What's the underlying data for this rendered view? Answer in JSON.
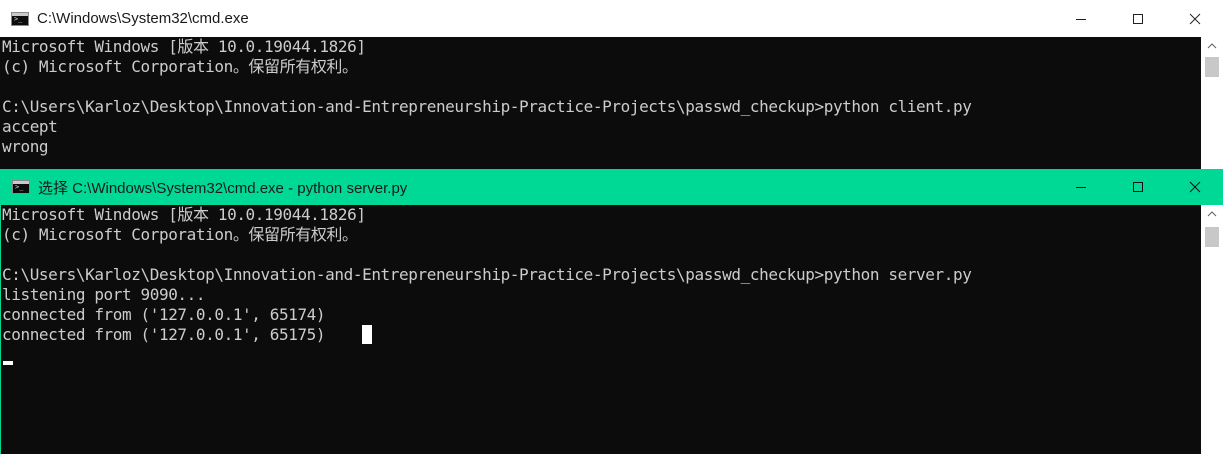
{
  "window_back": {
    "title": "C:\\Windows\\System32\\cmd.exe",
    "lines": [
      "Microsoft Windows [版本 10.0.19044.1826]",
      "(c) Microsoft Corporation。保留所有权利。",
      "",
      "C:\\Users\\Karloz\\Desktop\\Innovation-and-Entrepreneurship-Practice-Projects\\passwd_checkup>python client.py",
      "accept",
      "wrong"
    ]
  },
  "window_front": {
    "title": "选择 C:\\Windows\\System32\\cmd.exe - python  server.py",
    "lines": [
      "Microsoft Windows [版本 10.0.19044.1826]",
      "(c) Microsoft Corporation。保留所有权利。",
      "",
      "C:\\Users\\Karloz\\Desktop\\Innovation-and-Entrepreneurship-Practice-Projects\\passwd_checkup>python server.py",
      "listening port 9090...",
      "connected from ('127.0.0.1', 65174)",
      "connected from ('127.0.0.1', 65175)    "
    ]
  },
  "colors": {
    "console_bg": "#0c0c0c",
    "console_text": "#cccccc",
    "active_titlebar": "#00d895",
    "inactive_titlebar": "#ffffff"
  }
}
